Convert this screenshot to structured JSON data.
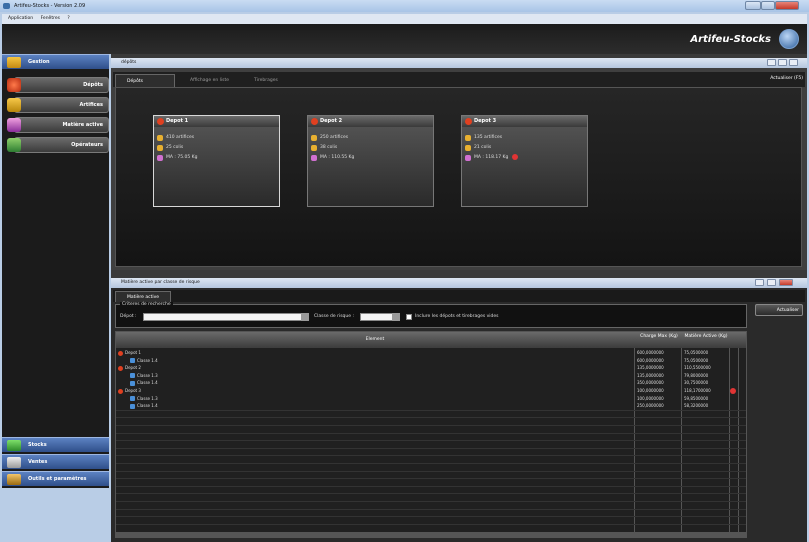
{
  "window": {
    "title": "Artifeu-Stocks - Version 2.09"
  },
  "menu": [
    "Application",
    "Fenêtres",
    "?"
  ],
  "brand": {
    "name": "Artifeu-Stocks"
  },
  "sidebar": {
    "groups": {
      "gestion": "Gestion",
      "stocks": "Stocks",
      "ventes": "Ventes",
      "outils": "Outils et paramètres"
    },
    "items": [
      {
        "label": "Dépôts"
      },
      {
        "label": "Artifices"
      },
      {
        "label": "Matière active"
      },
      {
        "label": "Opérateurs"
      }
    ]
  },
  "depots_panel": {
    "title": "dépôts",
    "tabs": [
      "Dépôts",
      "Affichage en liste",
      "Tirebrages"
    ],
    "refresh": "Actualiser (F5)",
    "cards": [
      {
        "name": "Depot 1",
        "artifices": "410 artifices",
        "colis": "25 colis",
        "ma": "MA : 75.05 Kg",
        "warning": false
      },
      {
        "name": "Depot 2",
        "artifices": "250 artifices",
        "colis": "38 colis",
        "ma": "MA : 110.55 Kg",
        "warning": false
      },
      {
        "name": "Depot 3",
        "artifices": "135 artifices",
        "colis": "21 colis",
        "ma": "MA : 118.17 Kg",
        "warning": true
      }
    ]
  },
  "matiere_panel": {
    "title": "Matière active par classe de risque",
    "tab": "Matière active",
    "criteria": {
      "legend": "Criteres de recherche",
      "depot_label": "Dépot :",
      "classe_label": "Classe de risque :",
      "include_label": "Inclure les dépots et tirebrages vides",
      "depot_value": "",
      "classe_value": ""
    },
    "refresh": "Actualiser",
    "columns": {
      "element": "Element",
      "charge": "Charge Max (Kg)",
      "matiere": "Matière Active (Kg)"
    },
    "rows": [
      {
        "level": 0,
        "name": "Depot 1",
        "charge": "600,0000000",
        "matiere": "75,0500000",
        "warning": false
      },
      {
        "level": 1,
        "name": "Classe 1.4",
        "charge": "600,0000000",
        "matiere": "75,0500000",
        "warning": false
      },
      {
        "level": 0,
        "name": "Depot 2",
        "charge": "135,0000000",
        "matiere": "110,5500000",
        "warning": false
      },
      {
        "level": 1,
        "name": "Classe 1.3",
        "charge": "135,0000000",
        "matiere": "79,8000000",
        "warning": false
      },
      {
        "level": 1,
        "name": "Classe 1.4",
        "charge": "350,0000000",
        "matiere": "30,7500000",
        "warning": false
      },
      {
        "level": 0,
        "name": "Depot 3",
        "charge": "100,0000000",
        "matiere": "118,1700000",
        "warning": true
      },
      {
        "level": 1,
        "name": "Classe 1.3",
        "charge": "100,0000000",
        "matiere": "59,8500000",
        "warning": false
      },
      {
        "level": 1,
        "name": "Classe 1.4",
        "charge": "250,0000000",
        "matiere": "58,3200000",
        "warning": false
      }
    ]
  }
}
